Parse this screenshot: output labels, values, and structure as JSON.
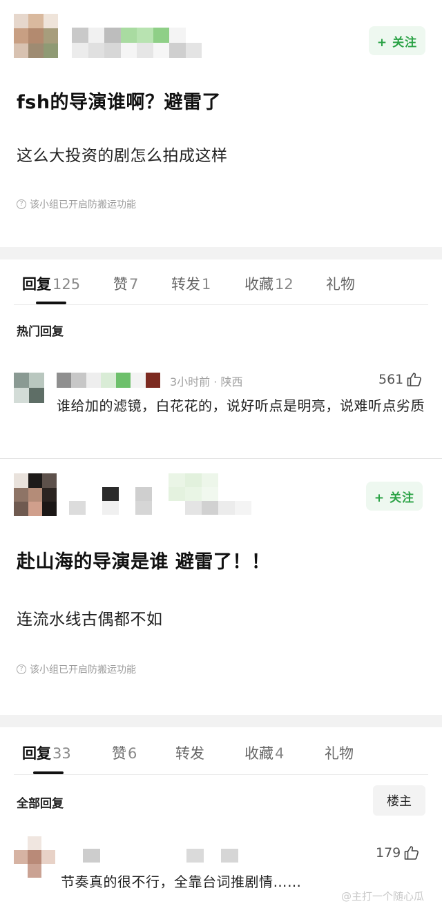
{
  "post1": {
    "follow_label": "+ 关注",
    "title": "fsh的导演谁啊？避雷了",
    "body": "这么大投资的剧怎么拍成这样",
    "notice": "该小组已开启防搬运功能",
    "tabs": [
      {
        "label": "回复",
        "count": "125"
      },
      {
        "label": "赞",
        "count": "7"
      },
      {
        "label": "转发",
        "count": "1"
      },
      {
        "label": "收藏",
        "count": "12"
      },
      {
        "label": "礼物",
        "count": ""
      }
    ],
    "section_title": "热门回复",
    "reply": {
      "meta": "3小时前 · 陕西",
      "likes": "561",
      "text": "谁给加的滤镜，白花花的，说好听点是明亮，说难听点劣质"
    }
  },
  "post2": {
    "follow_label": "+ 关注",
    "title": "赴山海的导演是谁 避雷了！！",
    "body": "连流水线古偶都不如",
    "notice": "该小组已开启防搬运功能",
    "tabs": [
      {
        "label": "回复",
        "count": "33"
      },
      {
        "label": "赞",
        "count": "6"
      },
      {
        "label": "转发",
        "count": ""
      },
      {
        "label": "收藏",
        "count": "4"
      },
      {
        "label": "礼物",
        "count": ""
      }
    ],
    "section_title": "全部回复",
    "owner_label": "楼主",
    "reply": {
      "likes": "179",
      "text": "节奏真的很不行，全靠台词推剧情……"
    }
  },
  "watermark": "@主打一个随心瓜",
  "icons": {
    "like": "thumbs-up-icon",
    "notice": "question-circle-icon"
  },
  "colors": {
    "accent_green": "#2aa245",
    "follow_bg": "#eef8f0",
    "separator": "#f2f2f2"
  }
}
